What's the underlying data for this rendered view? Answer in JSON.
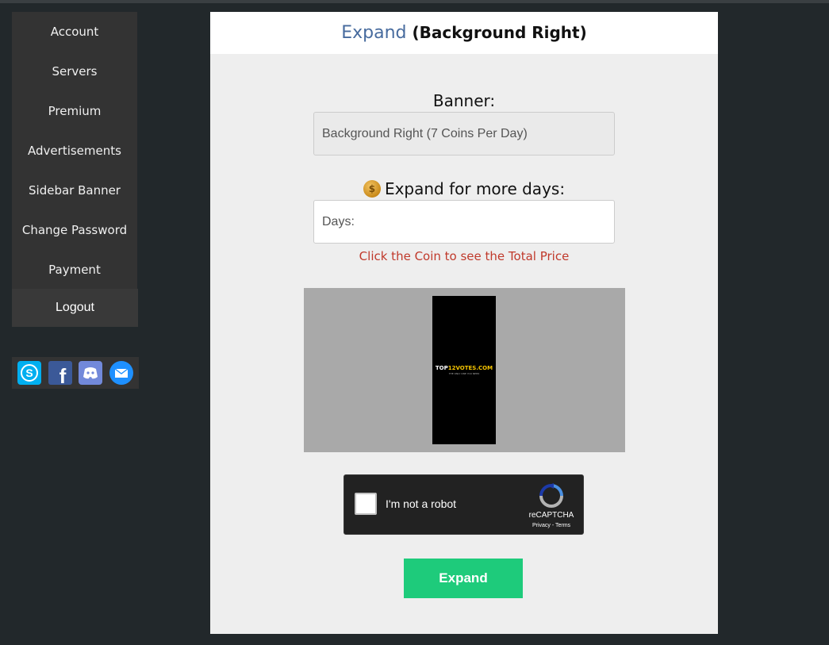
{
  "sidebar": {
    "items": [
      {
        "label": "Account"
      },
      {
        "label": "Servers"
      },
      {
        "label": "Premium"
      },
      {
        "label": "Advertisements"
      },
      {
        "label": "Sidebar Banner"
      },
      {
        "label": "Change Password"
      },
      {
        "label": "Payment"
      }
    ],
    "logout_label": "Logout"
  },
  "social": {
    "icons": [
      "skype-icon",
      "facebook-icon",
      "discord-icon",
      "email-icon"
    ],
    "colors": {
      "skype": "#00aff0",
      "facebook": "#3b5998",
      "discord": "#7289da",
      "email": "#1e90ff"
    }
  },
  "header": {
    "title_main": "Expand",
    "title_sub": "(Background Right)"
  },
  "form": {
    "banner_label": "Banner:",
    "banner_value": "Background Right (7 Coins Per Day)",
    "expand_label": "Expand for more days:",
    "days_placeholder": "Days:",
    "hint": "Click the Coin to see the Total Price"
  },
  "preview": {
    "logo_prefix": "TOP",
    "logo_brand": "12VOTES.COM",
    "logo_tagline": "THE ONLY ONE YOU NEED"
  },
  "captcha": {
    "label": "I'm not a robot",
    "brand": "reCAPTCHA",
    "links": "Privacy - Terms"
  },
  "actions": {
    "expand_button": "Expand"
  },
  "colors": {
    "background": "#22282b",
    "accent_blue": "#476b9e",
    "hint_red": "#c0392b",
    "button_green": "#1ecb7b"
  }
}
